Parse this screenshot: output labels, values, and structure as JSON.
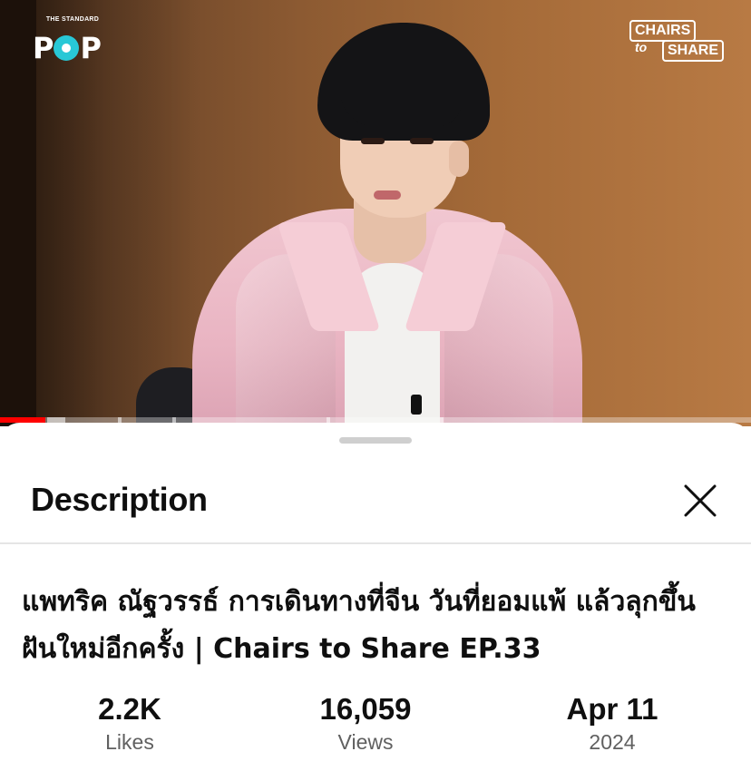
{
  "video": {
    "logo_left_small": "THE STANDARD",
    "logo_left_main": "POP",
    "logo_right_line1": "CHAIRS",
    "logo_right_line2": "to",
    "logo_right_line3": "SHARE",
    "progress_played_fraction": 0.06,
    "jacket_color": "#f1c7d1"
  },
  "description_sheet": {
    "heading": "Description",
    "close_icon": "close-icon",
    "title": "แพทริค ณัฐวรรธ์ การเดินทางที่จีน วันที่ยอมแพ้ แล้วลุกขึ้นฝันใหม่อีกครั้ง | Chairs to Share EP.33",
    "stats": {
      "likes": {
        "value": "2.2K",
        "label": "Likes"
      },
      "views": {
        "value": "16,059",
        "label": "Views"
      },
      "date": {
        "value": "Apr 11",
        "label": "2024"
      }
    }
  },
  "colors": {
    "progress_red": "#ff0000",
    "text_primary": "#0f0f0f",
    "text_secondary": "#606060"
  }
}
